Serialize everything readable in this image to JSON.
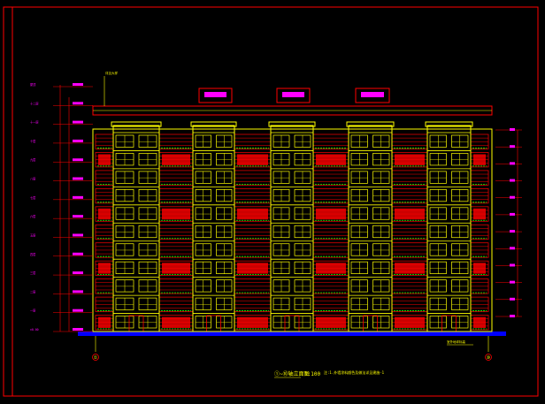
{
  "drawing": {
    "title_block": {
      "title": "①~⑩轴立面图",
      "scale": "1:100",
      "note": "注:1.外墙涂料颜色及做法详见建施-1"
    },
    "level_tags": [
      "屋顶",
      "十二层",
      "十一层",
      "十层",
      "九层",
      "八层",
      "七层",
      "六层",
      "五层",
      "四层",
      "三层",
      "二层",
      "一层",
      "±0.00"
    ],
    "grid_bubbles": {
      "left": "①",
      "right": "⑩"
    },
    "callouts": {
      "top_left": "详见大样",
      "bottom_right": "室外地坪标高"
    },
    "colors": {
      "background": "#000000",
      "frame": "#ff0000",
      "wall": "#ffff00",
      "accent": "#ff00ff",
      "detail": "#00ff00",
      "ground": "#0000ff"
    },
    "floors": 11,
    "bays": 4
  }
}
